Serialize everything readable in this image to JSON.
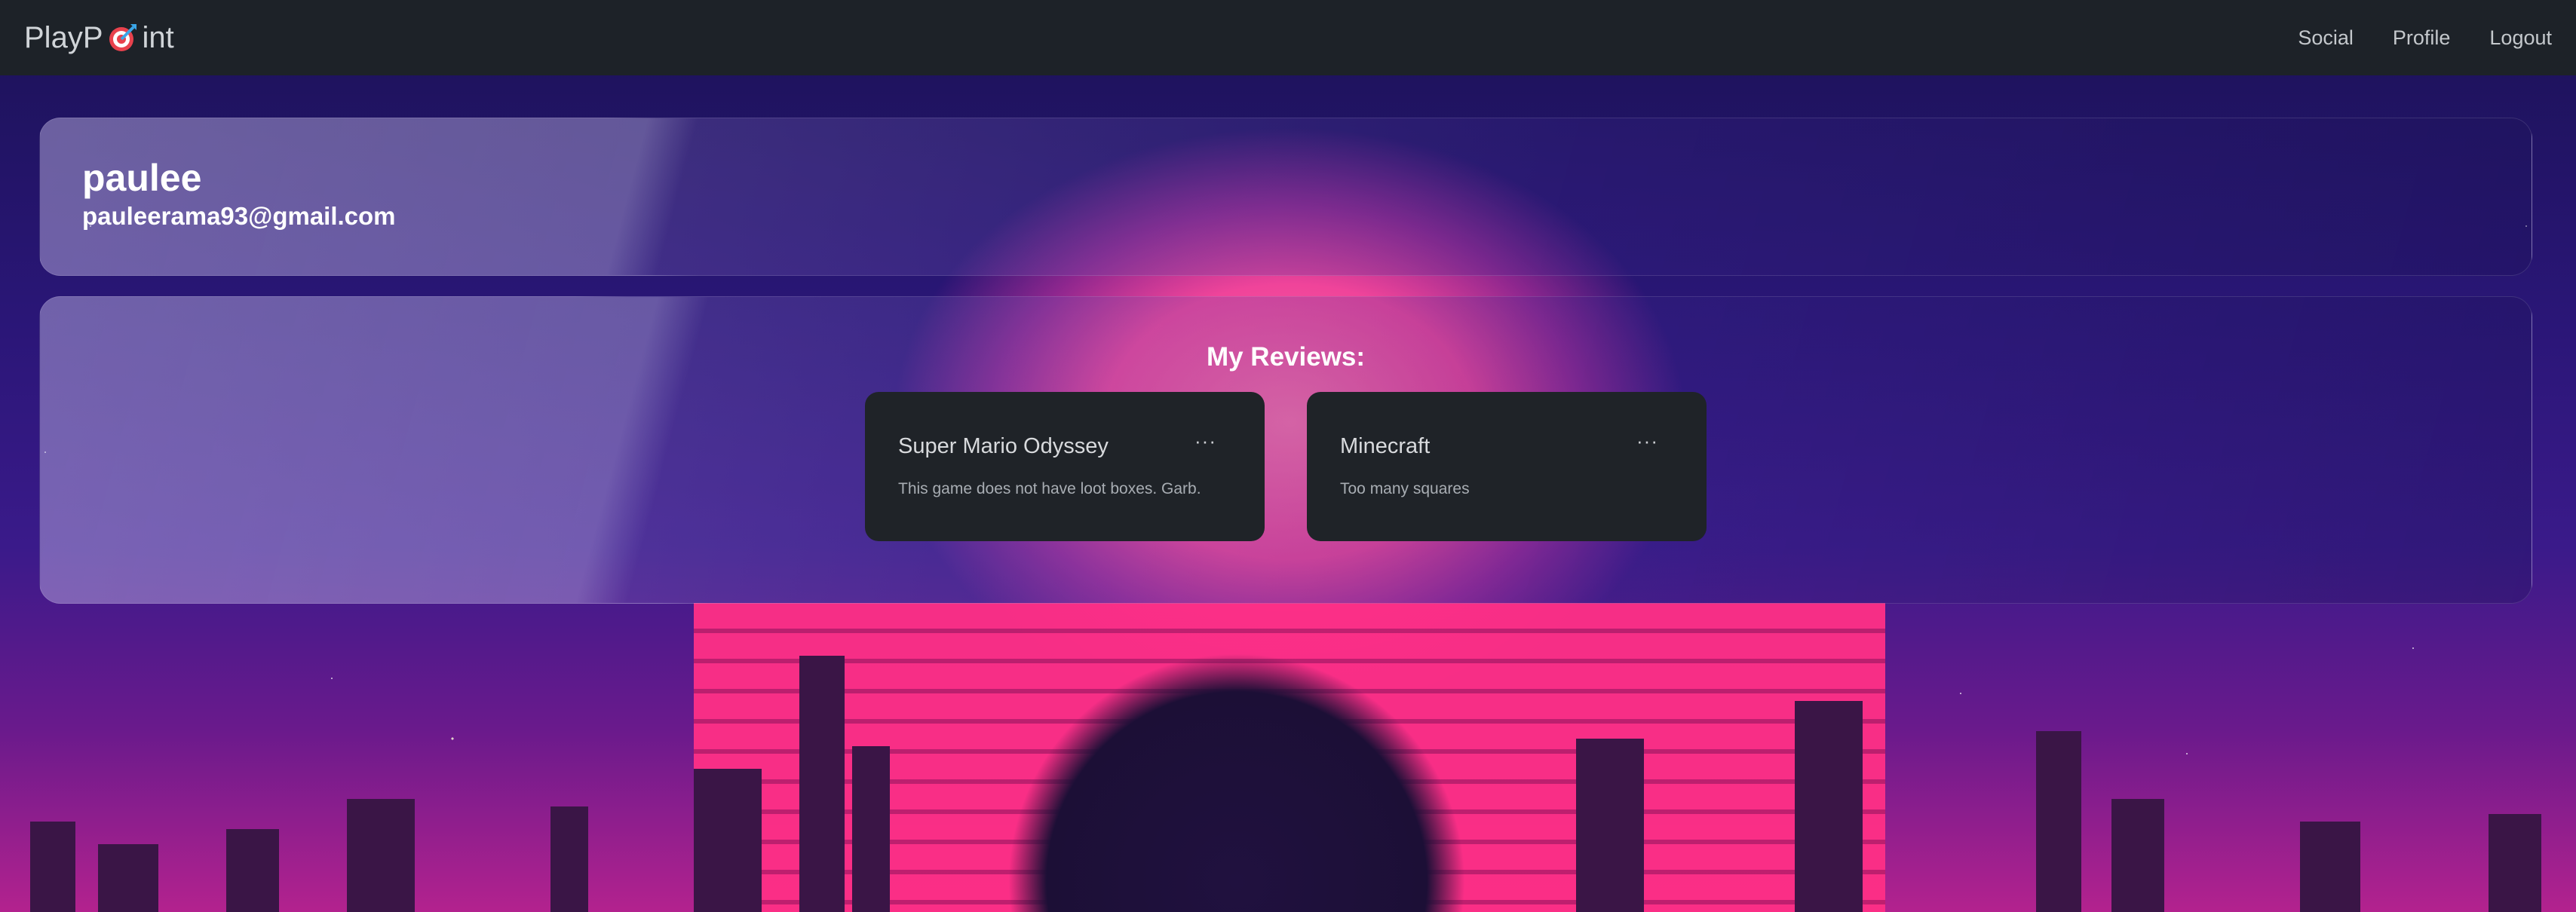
{
  "navbar": {
    "brand_prefix": "PlayP",
    "brand_suffix": "int",
    "brand_icon": "target-icon",
    "links": [
      "Social",
      "Profile",
      "Logout"
    ]
  },
  "profile": {
    "username": "paulee",
    "email": "pauleerama93@gmail.com"
  },
  "reviews": {
    "title": "My Reviews:",
    "items": [
      {
        "game": "Super Mario Odyssey",
        "text": "This game does not have loot boxes. Garb.",
        "menu": "···"
      },
      {
        "game": "Minecraft",
        "text": "Too many squares",
        "menu": "···"
      }
    ]
  },
  "colors": {
    "navbar_bg": "#1d2228",
    "card_bg": "#1f2328",
    "accent_sun": "#ff2f86"
  }
}
